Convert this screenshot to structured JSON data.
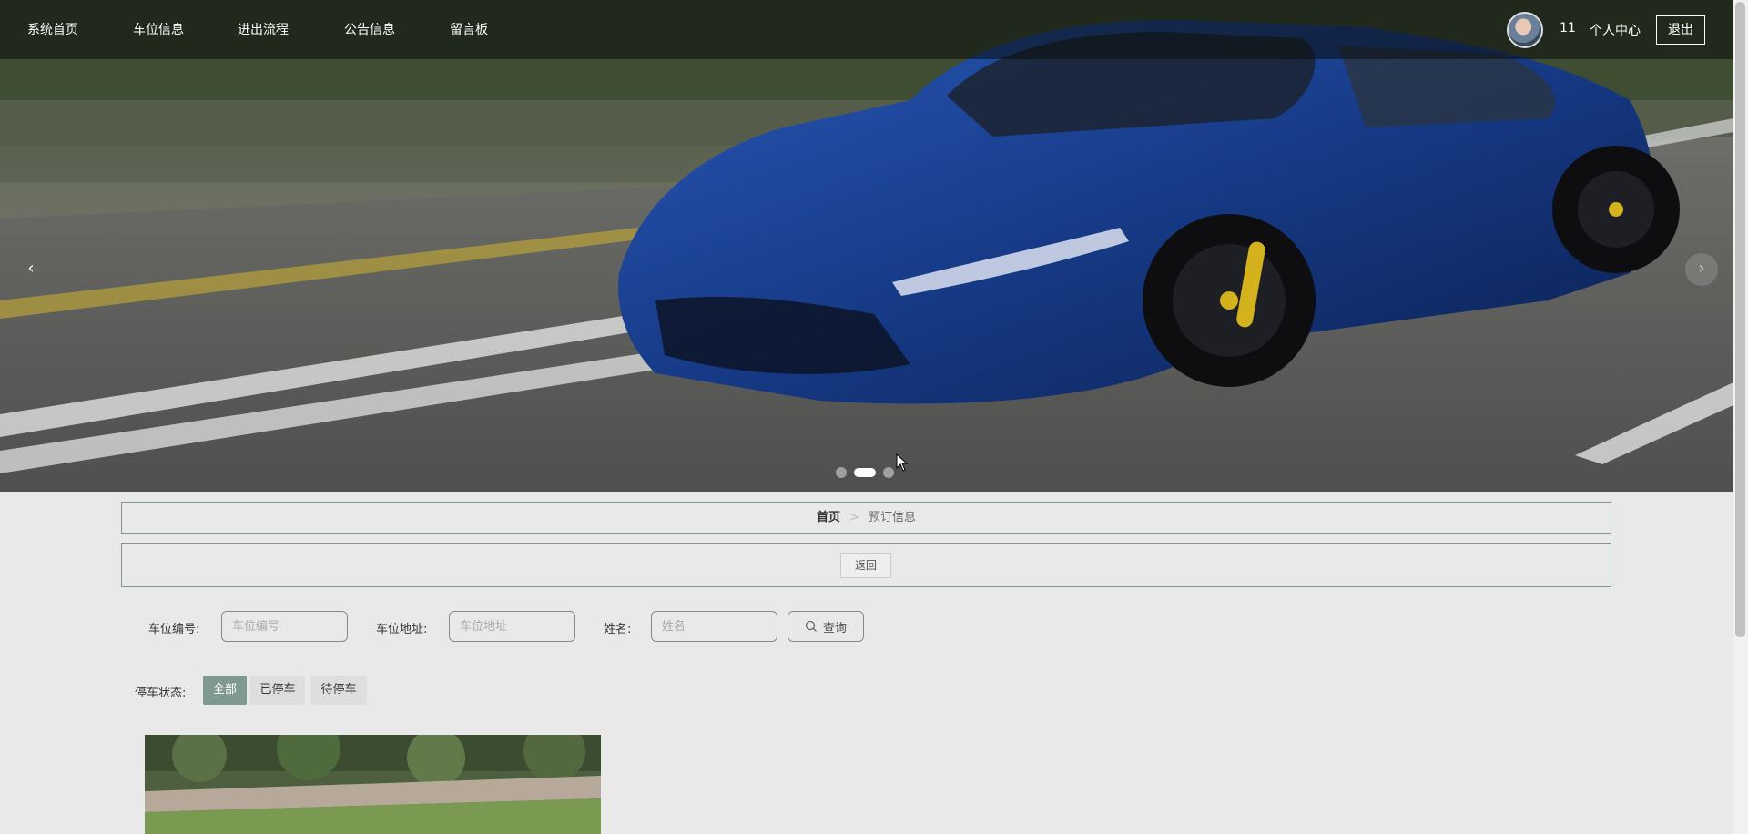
{
  "nav": {
    "items": [
      "系统首页",
      "车位信息",
      "进出流程",
      "公告信息",
      "留言板"
    ],
    "user_id": "11",
    "user_center": "个人中心",
    "logout": "退出"
  },
  "carousel": {
    "prev": "‹",
    "next": "›",
    "slides": 3,
    "active_slide": 2
  },
  "breadcrumb": {
    "home": "首页",
    "separator": ">",
    "current": "预订信息"
  },
  "back_button": "返回",
  "search": {
    "fields": [
      {
        "label": "车位编号:",
        "placeholder": "车位编号"
      },
      {
        "label": "车位地址:",
        "placeholder": "车位地址"
      },
      {
        "label": "姓名:",
        "placeholder": "姓名"
      }
    ],
    "button": "查询"
  },
  "status_filter": {
    "label": "停车状态:",
    "options": [
      "全部",
      "已停车",
      "待停车"
    ],
    "selected": "全部"
  },
  "colors": {
    "accent": "#7f998f",
    "background": "#e9e9e9"
  }
}
